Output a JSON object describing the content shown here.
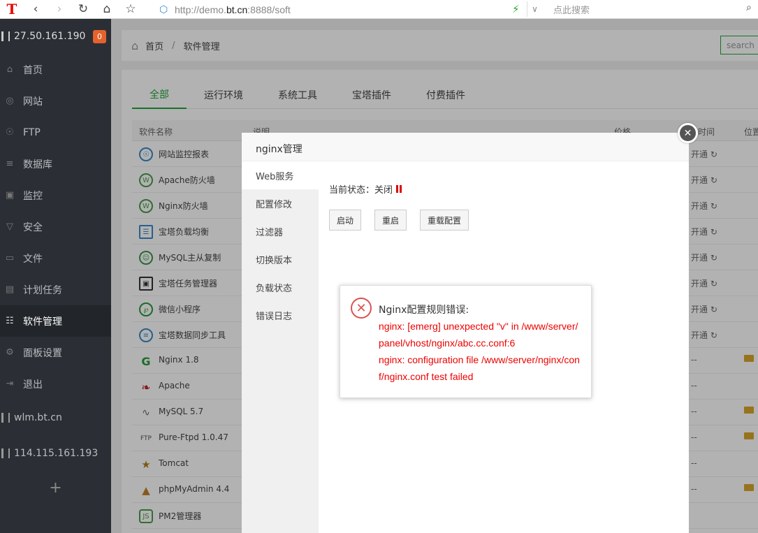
{
  "browser": {
    "url_prefix": "http://demo.",
    "url_domain": "bt.cn",
    "url_suffix": ":8888/soft",
    "search_placeholder": "点此搜索"
  },
  "sidebar": {
    "server_ip": "27.50.161.190",
    "badge_count": "0",
    "menu": [
      {
        "label": "首页",
        "icon": "home-icon"
      },
      {
        "label": "网站",
        "icon": "globe-icon"
      },
      {
        "label": "FTP",
        "icon": "ftp-icon"
      },
      {
        "label": "数据库",
        "icon": "database-icon"
      },
      {
        "label": "监控",
        "icon": "monitor-icon"
      },
      {
        "label": "安全",
        "icon": "shield-icon"
      },
      {
        "label": "文件",
        "icon": "folder-icon"
      },
      {
        "label": "计划任务",
        "icon": "calendar-icon"
      },
      {
        "label": "软件管理",
        "icon": "grid-icon"
      },
      {
        "label": "面板设置",
        "icon": "gear-icon"
      },
      {
        "label": "退出",
        "icon": "logout-icon"
      }
    ],
    "other_servers": [
      "wlm.bt.cn",
      "114.115.161.193"
    ],
    "add_label": "+"
  },
  "breadcrumb": {
    "home": "首页",
    "current": "软件管理"
  },
  "top_search": "search",
  "tabs": [
    "全部",
    "运行环境",
    "系统工具",
    "宝塔插件",
    "付费插件"
  ],
  "table": {
    "headers": {
      "name": "软件名称",
      "desc": "说明",
      "price": "价格",
      "time": "时间",
      "position": "位置"
    },
    "rows": [
      {
        "name": "网站监控报表",
        "extra": "开通 ↻"
      },
      {
        "name": "Apache防火墙",
        "extra": "开通 ↻"
      },
      {
        "name": "Nginx防火墙",
        "extra": "开通 ↻"
      },
      {
        "name": "宝塔负载均衡",
        "extra": "开通 ↻"
      },
      {
        "name": "MySQL主从复制",
        "extra": "开通 ↻"
      },
      {
        "name": "宝塔任务管理器",
        "extra": "开通 ↻"
      },
      {
        "name": "微信小程序",
        "extra": "开通 ↻"
      },
      {
        "name": "宝塔数据同步工具",
        "extra": "开通 ↻"
      },
      {
        "name": "Nginx 1.8",
        "extra": "--"
      },
      {
        "name": "Apache",
        "extra": "--"
      },
      {
        "name": "MySQL 5.7",
        "extra": "--"
      },
      {
        "name": "Pure-Ftpd 1.0.47",
        "extra": "--"
      },
      {
        "name": "Tomcat",
        "extra": "--"
      },
      {
        "name": "phpMyAdmin 4.4",
        "extra": "--"
      },
      {
        "name": "PM2管理器",
        "extra": ""
      }
    ]
  },
  "dialog": {
    "title": "nginx管理",
    "nav": [
      "Web服务",
      "配置修改",
      "过滤器",
      "切换版本",
      "负载状态",
      "错误日志"
    ],
    "status_label": "当前状态：关闭",
    "buttons": {
      "start": "启动",
      "restart": "重启",
      "reload": "重载配置"
    }
  },
  "error": {
    "title": "Nginx配置规则错误:",
    "line1": "nginx: [emerg] unexpected \"v\" in /www/server/panel/vhost/nginx/abc.cc.conf:6",
    "line2": "nginx: configuration file /www/server/nginx/conf/nginx.conf test failed"
  },
  "colors": {
    "accent": "#20a53a",
    "sidebar_bg": "#2b2f35",
    "badge": "#e4622c",
    "error": "#ee0000"
  }
}
